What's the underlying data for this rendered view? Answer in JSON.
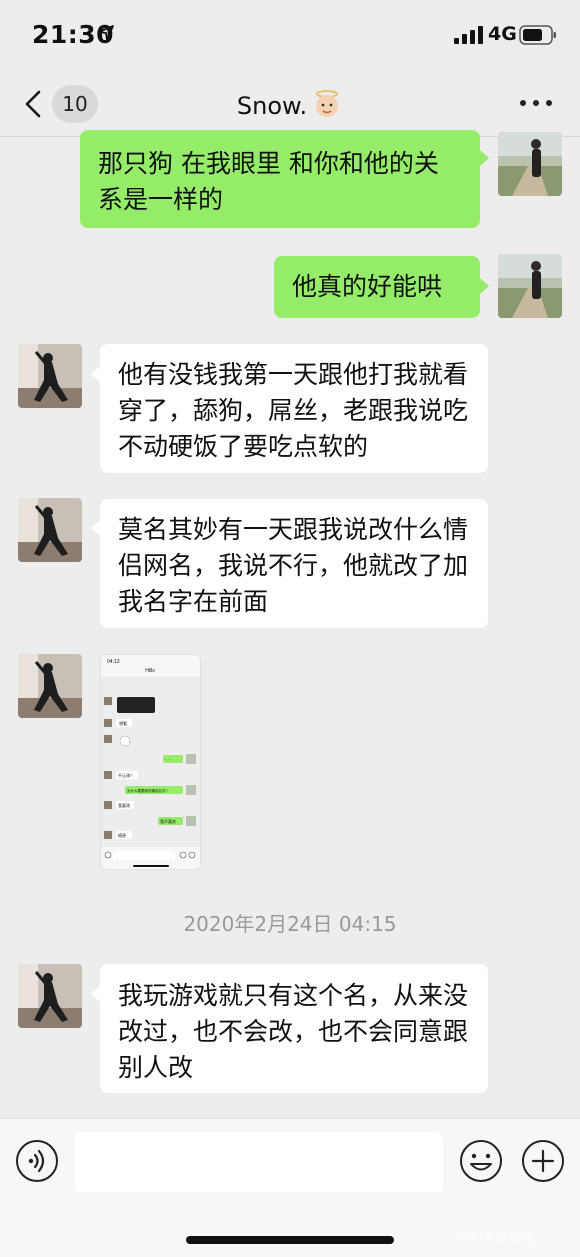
{
  "status_bar": {
    "time": "21:30",
    "network": "4G"
  },
  "nav": {
    "unread_count": "10",
    "title": "Snow."
  },
  "messages": [
    {
      "side": "right",
      "text": "那只狗 在我眼里 和你和他的关系是一样的"
    },
    {
      "side": "right",
      "text": "他真的好能哄"
    },
    {
      "side": "left",
      "text": "他有没钱我第一天跟他打我就看穿了，舔狗，屌丝，老跟我说吃不动硬饭了要吃点软的"
    },
    {
      "side": "left",
      "text": "莫名其妙有一天跟我说改什么情侣网名，我说不行，他就改了加我名字在前面"
    },
    {
      "side": "left",
      "type": "image",
      "image": {
        "time": "04:13",
        "title": "Hills",
        "lines": [
          "想看",
          "· · ·",
          "不让改?",
          "为什么要跟我的情侣名字?",
          "我要改",
          "我不喜欢",
          "随便"
        ]
      }
    },
    {
      "side": "left",
      "text": "我玩游戏就只有这个名，从来没改过，也不会改，也不会同意跟别人改"
    }
  ],
  "timestamp": "2020年2月24日 04:15",
  "watermark": "@和平精英吧",
  "colors": {
    "outgoing_bubble": "#95ec69",
    "incoming_bubble": "#ffffff",
    "background": "#ededed"
  }
}
